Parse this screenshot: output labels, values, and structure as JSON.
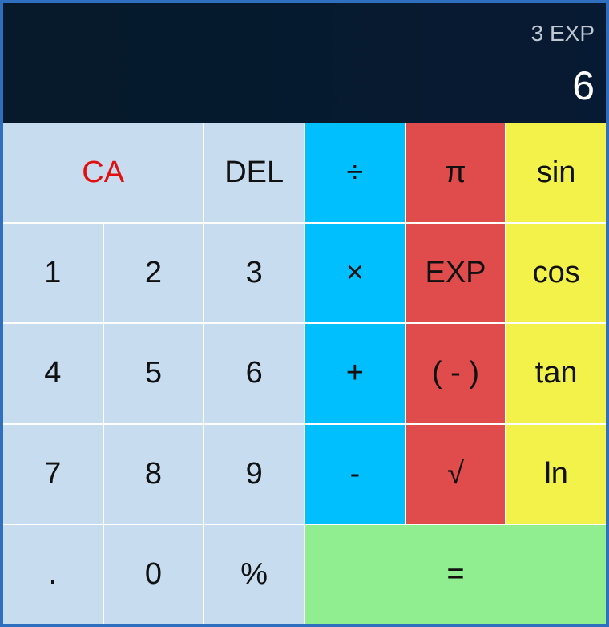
{
  "display": {
    "expression": "3 EXP",
    "result": "6"
  },
  "keys": {
    "ca": "CA",
    "del": "DEL",
    "divide": "÷",
    "pi": "π",
    "sin": "sin",
    "one": "1",
    "two": "2",
    "three": "3",
    "multiply": "×",
    "exp": "EXP",
    "cos": "cos",
    "four": "4",
    "five": "5",
    "six": "6",
    "plus": "+",
    "negate": "( - )",
    "tan": "tan",
    "seven": "7",
    "eight": "8",
    "nine": "9",
    "minus": "-",
    "sqrt": "√",
    "ln": "ln",
    "decimal": ".",
    "zero": "0",
    "percent": "%",
    "equals": "="
  },
  "colors": {
    "number_key": "#c8dcf0",
    "operator_key": "#00bfff",
    "function_key": "#e04b4b",
    "trig_key": "#f2f24a",
    "equals_key": "#90ee90",
    "clear_text": "#e01010",
    "display_bg": "#061a2b"
  }
}
